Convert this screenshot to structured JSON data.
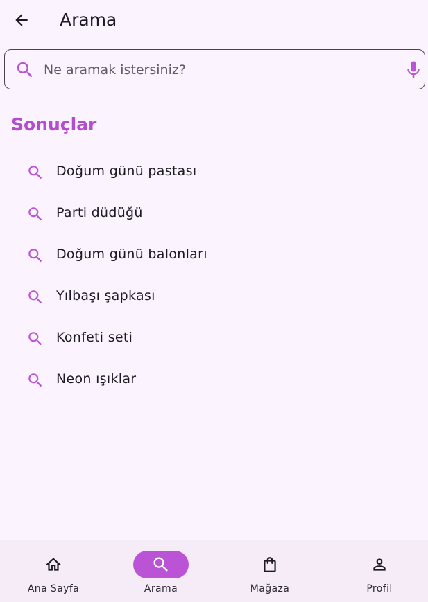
{
  "colors": {
    "background": "#fbf3fd",
    "accent": "#bb53d6",
    "section_title": "#b54cd0",
    "text": "#1d1b20"
  },
  "appbar": {
    "back_icon": "arrow-back-icon",
    "title": "Arama"
  },
  "search": {
    "placeholder": "Ne aramak istersiniz?",
    "value": "",
    "leading_icon": "search-icon",
    "trailing_icon": "mic-icon"
  },
  "results": {
    "title": "Sonuçlar",
    "items": [
      {
        "label": "Doğum günü pastası",
        "icon": "search-icon"
      },
      {
        "label": "Parti düdüğü",
        "icon": "search-icon"
      },
      {
        "label": "Doğum günü balonları",
        "icon": "search-icon"
      },
      {
        "label": "Yılbaşı şapkası",
        "icon": "search-icon"
      },
      {
        "label": "Konfeti seti",
        "icon": "search-icon"
      },
      {
        "label": "Neon ışıklar",
        "icon": "search-icon"
      }
    ]
  },
  "bottom_nav": {
    "items": [
      {
        "label": "Ana Sayfa",
        "icon": "home-icon",
        "active": false
      },
      {
        "label": "Arama",
        "icon": "search-icon",
        "active": true
      },
      {
        "label": "Mağaza",
        "icon": "shopping-bag-icon",
        "active": false
      },
      {
        "label": "Profil",
        "icon": "person-icon",
        "active": false
      }
    ]
  }
}
